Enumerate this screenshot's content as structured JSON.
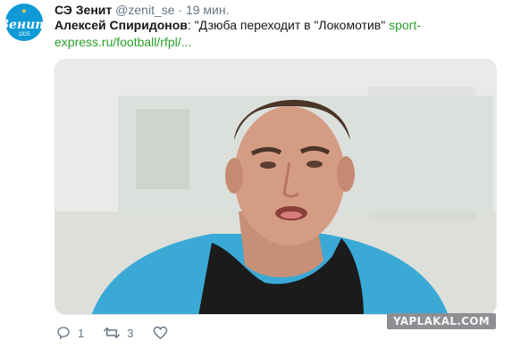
{
  "tweet": {
    "author_name": "СЭ Зенит",
    "handle": "@zenit_se",
    "separator": "·",
    "time": "19 мин.",
    "quoted_author": "Алексей Спиридонов",
    "quote_text": ": \"Дзюба переходит в \"Локомотив\" ",
    "link": "sport-express.ru/football/rfpl/...",
    "avatar": {
      "logo_text": "Зенит",
      "logo_year": "1925",
      "colors": {
        "background": "#0f9ad6"
      }
    }
  },
  "actions": {
    "reply_count": "1",
    "retweet_count": "3",
    "like_count": ""
  },
  "watermark": "YAPLAKAL.COM",
  "colors": {
    "link": "#2aa02a",
    "meta": "#657786"
  }
}
